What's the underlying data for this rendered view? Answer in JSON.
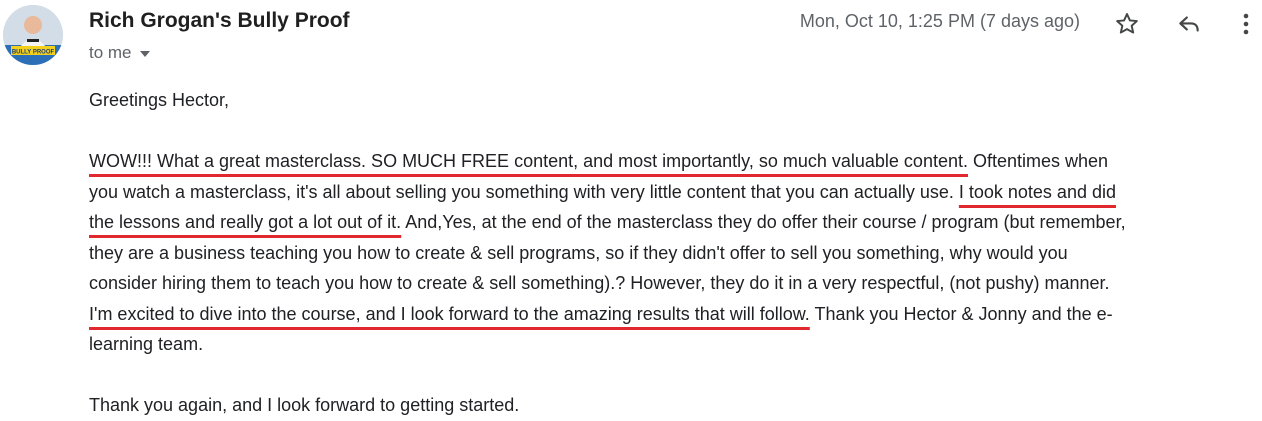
{
  "header": {
    "sender_name": "Rich Grogan's Bully Proof",
    "recipient_label": "to me",
    "date_text": "Mon, Oct 10, 1:25 PM (7 days ago)",
    "icons": {
      "star": "star-icon",
      "reply": "reply-icon",
      "more": "more-vert-icon",
      "caret": "chevron-down-icon"
    },
    "avatar_text": "BULLY PROOF"
  },
  "email": {
    "greeting": "Greetings Hector,",
    "para2": {
      "l1_hl": "WOW!!! What a great masterclass. SO MUCH FREE content, and most importantly, so much valuable content.",
      "l1_rest": " Oftentimes when",
      "l2_plain": "you watch a masterclass, it's all about selling you something with very little content that you can actually use. ",
      "l2_hl": "I took notes and did",
      "l3_hl": "the lessons and really got a lot out of it.",
      "l3_rest": " And,Yes, at the end of the masterclass they do offer their course / program (but remember,",
      "l4": "they are a business teaching you how to create & sell programs, so if they didn't offer to sell you something, why would you",
      "l5": "consider hiring them to teach you how to create & sell something).? However, they do it in a very respectful, (not pushy) manner.",
      "l6_hl": "I'm excited to dive into the course, and I look forward to the amazing results that will follow.",
      "l6_rest": " Thank you Hector & Jonny and the e-",
      "l7": "learning team."
    },
    "closing": "Thank you again, and I look forward to getting started."
  },
  "colors": {
    "underline_highlight": "#e0282e",
    "text": "#202124",
    "muted": "#5f6368"
  }
}
